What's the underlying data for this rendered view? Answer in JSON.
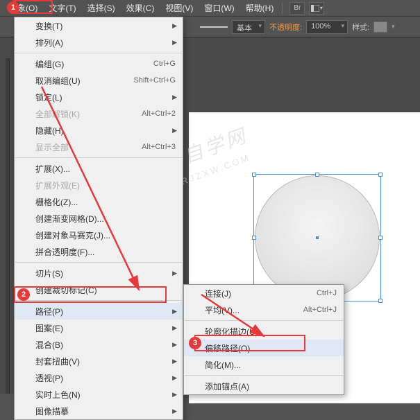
{
  "menubar": {
    "items": [
      "对象(O)",
      "文字(T)",
      "选择(S)",
      "效果(C)",
      "视图(V)",
      "窗口(W)",
      "帮助(H)"
    ],
    "br_btn": "Br"
  },
  "toolbar": {
    "stroke_style": "基本",
    "opacity_label": "不透明度:",
    "opacity_value": "100%",
    "style_label": "样式:"
  },
  "menu1": [
    {
      "label": "变换(T)",
      "sub": true
    },
    {
      "label": "排列(A)",
      "sub": true
    },
    {
      "sep": true
    },
    {
      "label": "编组(G)",
      "shortcut": "Ctrl+G"
    },
    {
      "label": "取消编组(U)",
      "shortcut": "Shift+Ctrl+G"
    },
    {
      "label": "锁定(L)",
      "sub": true
    },
    {
      "label": "全部解锁(K)",
      "shortcut": "Alt+Ctrl+2",
      "disabled": true
    },
    {
      "label": "隐藏(H)",
      "sub": true
    },
    {
      "label": "显示全部",
      "shortcut": "Alt+Ctrl+3",
      "disabled": true
    },
    {
      "sep": true
    },
    {
      "label": "扩展(X)..."
    },
    {
      "label": "扩展外观(E)",
      "disabled": true
    },
    {
      "label": "栅格化(Z)..."
    },
    {
      "label": "创建渐变网格(D)..."
    },
    {
      "label": "创建对象马赛克(J)..."
    },
    {
      "label": "拼合透明度(F)..."
    },
    {
      "sep": true
    },
    {
      "label": "切片(S)",
      "sub": true
    },
    {
      "label": "创建裁切标记(C)"
    },
    {
      "sep": true
    },
    {
      "label": "路径(P)",
      "sub": true,
      "hover": true
    },
    {
      "label": "图案(E)",
      "sub": true
    },
    {
      "label": "混合(B)",
      "sub": true
    },
    {
      "label": "封套扭曲(V)",
      "sub": true
    },
    {
      "label": "透视(P)",
      "sub": true
    },
    {
      "label": "实时上色(N)",
      "sub": true
    },
    {
      "label": "图像描摹",
      "sub": true
    }
  ],
  "menu2": [
    {
      "label": "连接(J)",
      "shortcut": "Ctrl+J"
    },
    {
      "label": "平均(V)...",
      "shortcut": "Alt+Ctrl+J"
    },
    {
      "sep": true
    },
    {
      "label": "轮廓化描边(U)"
    },
    {
      "label": "偏移路径(O)...",
      "hover": true
    },
    {
      "label": "简化(M)..."
    },
    {
      "sep": true
    },
    {
      "label": "添加锚点(A)"
    }
  ],
  "badges": {
    "b1": "1",
    "b2": "2",
    "b3": "3"
  },
  "watermark": {
    "main": "软件自学网",
    "sub": "WWW.RJZXW.COM"
  }
}
